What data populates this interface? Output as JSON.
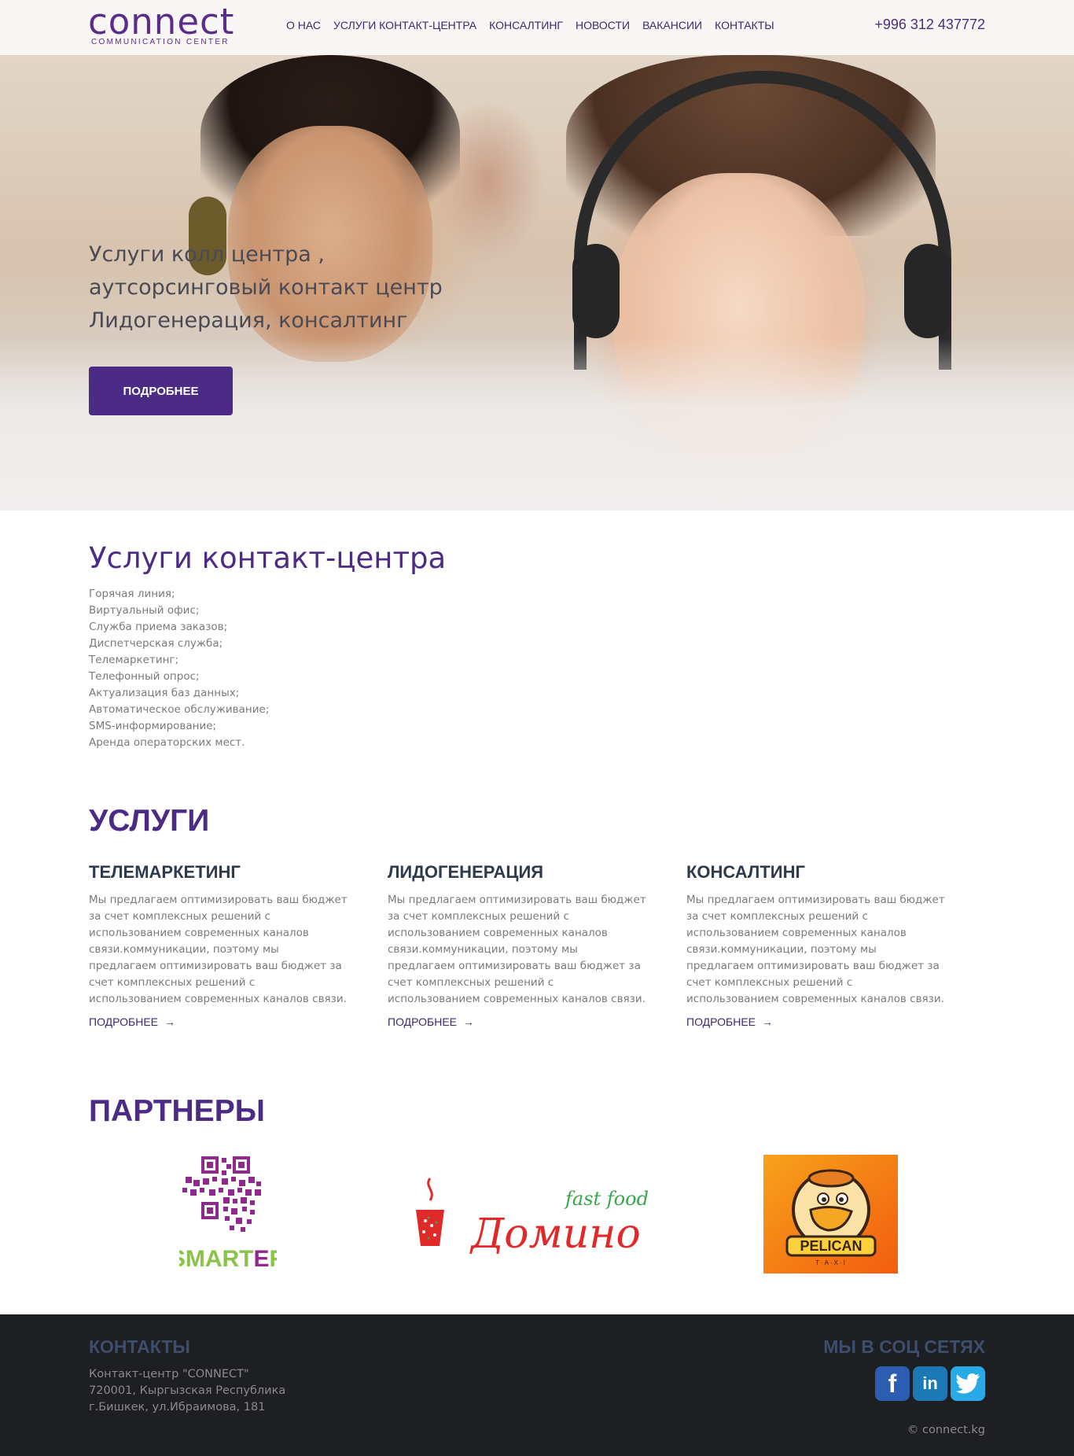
{
  "header": {
    "logo_word": "connect",
    "logo_sub": "COMMUNICATION CENTER",
    "nav": [
      "О НАС",
      "УСЛУГИ КОНТАКТ-ЦЕНТРА",
      "КОНСАЛТИНГ",
      "НОВОСТИ",
      "ВАКАНСИИ",
      "КОНТАКТЫ"
    ],
    "phone": "+996 312 437772"
  },
  "hero": {
    "lines": [
      "Услуги колл центра ,",
      "аутсорсинговый контакт центр",
      "Лидогенерация, консалтинг"
    ],
    "button": "ПОДРОБНЕЕ"
  },
  "contact_services": {
    "title": "Услуги контакт-центра",
    "items": [
      "Горячая линия;",
      "Виртуальный офис;",
      "Служба приема заказов;",
      "Диспетчерская служба;",
      "Телемаркетинг;",
      "Телефонный опрос;",
      "Актуализация баз данных;",
      "Автоматическое обслуживание;",
      "SMS-информирование;",
      "Аренда операторских мест."
    ]
  },
  "services": {
    "title": "УСЛУГИ",
    "cards": [
      {
        "title": "ТЕЛЕМАРКЕТИНГ",
        "text": "Мы предлагаем оптимизировать ваш бюджет за счет комплексных решений с использованием современных каналов связи.коммуникации, поэтому мы предлагаем оптимизировать ваш бюджет за счет комплексных решений с использованием современных каналов связи.",
        "more": "ПОДРОБНЕЕ"
      },
      {
        "title": "ЛИДОГЕНЕРАЦИЯ",
        "text": "Мы предлагаем оптимизировать ваш бюджет за счет комплексных решений с использованием современных каналов связи.коммуникации, поэтому мы предлагаем оптимизировать ваш бюджет за счет комплексных решений с использованием современных каналов связи.",
        "more": "ПОДРОБНЕЕ"
      },
      {
        "title": "КОНСАЛТИНГ",
        "text": "Мы предлагаем оптимизировать ваш бюджет за счет комплексных решений с использованием современных каналов связи.коммуникации, поэтому мы предлагаем оптимизировать ваш бюджет за счет комплексных решений с использованием современных каналов связи.",
        "more": "ПОДРОБНЕЕ"
      }
    ]
  },
  "partners": {
    "title": "ПАРТНЕРЫ",
    "logos": [
      {
        "name": "SMARTER",
        "icon": "smarter-logo"
      },
      {
        "name": "Домино",
        "tagline": "fast food",
        "icon": "domino-logo"
      },
      {
        "name": "PELICAN",
        "tagline": "T·A·X·I",
        "icon": "pelican-taxi-logo"
      }
    ]
  },
  "footer": {
    "contacts_title": "КОНТАКТЫ",
    "address": [
      "Контакт-центр \"CONNECT\"",
      "720001, Кыргызская Республика",
      "г.Бишкек, ул.Ибраимова, 181"
    ],
    "social_title": "МЫ В СОЦ СЕТЯХ",
    "socials": [
      "facebook-icon",
      "linkedin-icon",
      "twitter-icon"
    ],
    "copyright": "© connect.kg"
  },
  "colors": {
    "brand": "#4b2b85",
    "footer_bg": "#1d1f22",
    "header_bg": "#f8f7f5"
  }
}
